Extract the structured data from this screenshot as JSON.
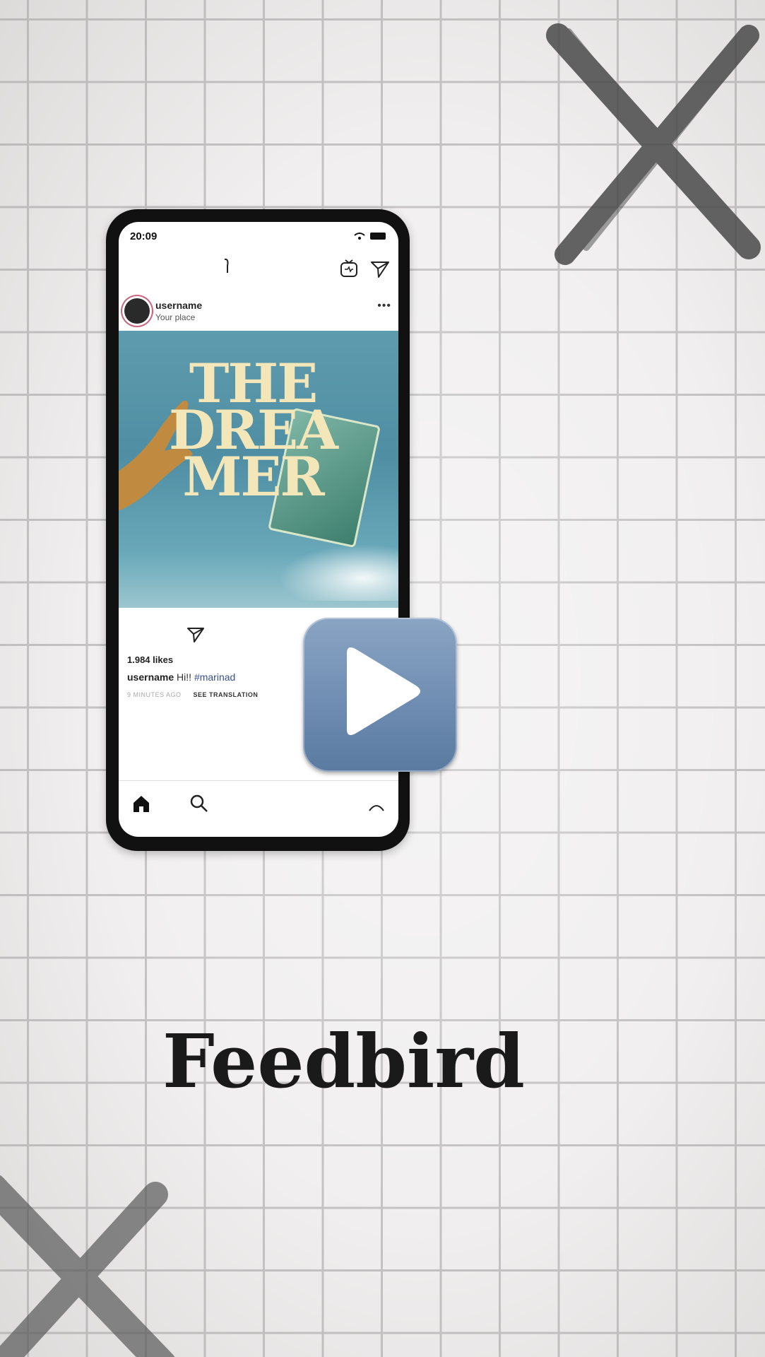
{
  "status": {
    "time": "20:09"
  },
  "post": {
    "username": "username",
    "place": "Your place",
    "image_title_lines": [
      "THE",
      "DREA",
      "MER"
    ],
    "likes": "1.984 likes",
    "caption_user": "username",
    "caption_text": "Hi!!",
    "hashtag": "#marinad",
    "time_ago": "9 MINUTES AGO",
    "see_translation": "SEE TRANSLATION"
  },
  "brand": {
    "name": "Feedbird"
  },
  "colors": {
    "play_button": "#6f8db2",
    "grid": "#c4c2c3",
    "background": "#f1efef",
    "title_text": "#f3e6b9"
  },
  "icons": [
    "igtv-icon",
    "send-icon",
    "more-icon",
    "home-icon",
    "search-icon",
    "play-icon",
    "x-mark-icon"
  ]
}
